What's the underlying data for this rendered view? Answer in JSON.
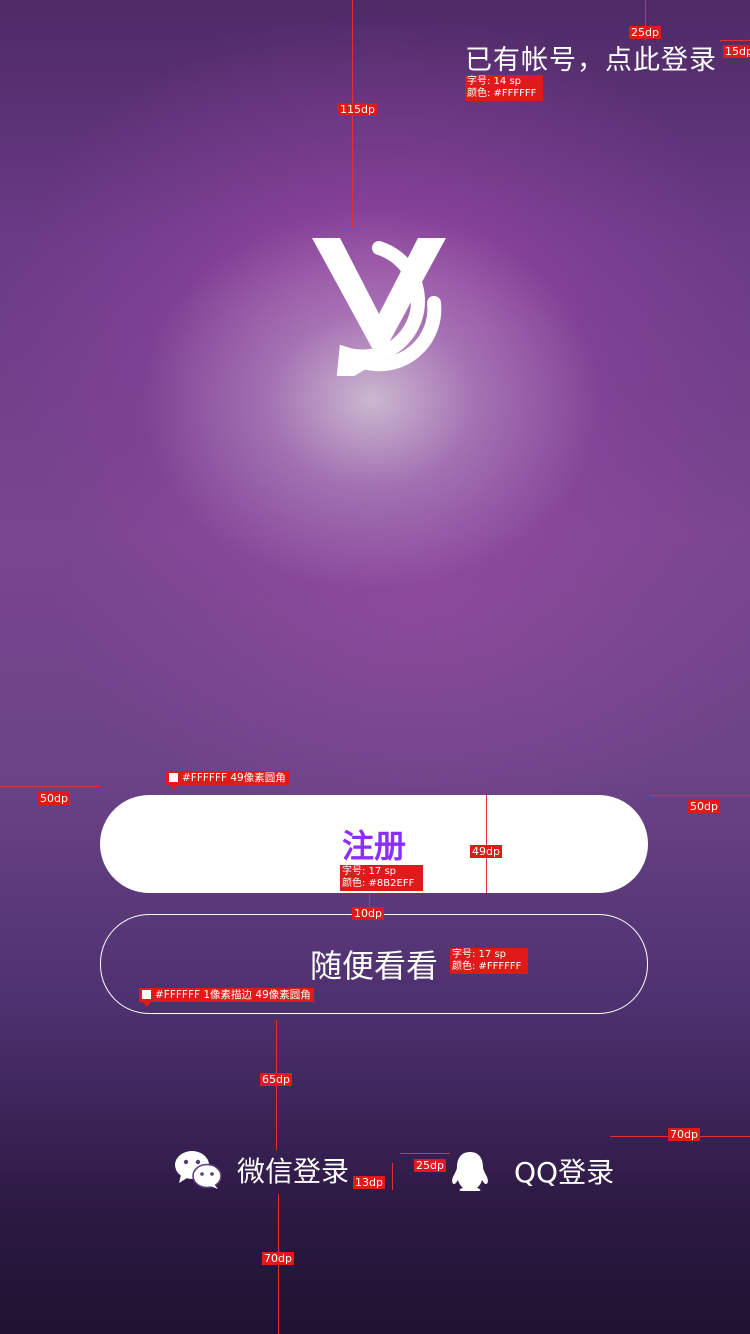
{
  "header": {
    "login_link": "已有帐号，点此登录"
  },
  "logo": {
    "name": "v-chat-logo-icon"
  },
  "buttons": {
    "register": "注册",
    "browse": "随便看看"
  },
  "social": {
    "wechat": {
      "label": "微信登录",
      "icon": "wechat-icon"
    },
    "qq": {
      "label": "QQ登录",
      "icon": "qq-icon"
    }
  },
  "colors": {
    "register_text": "#8B2EFF",
    "text": "#FFFFFF",
    "button_fill": "#FFFFFF",
    "annotation": "#E01A1A"
  },
  "annotations": {
    "top_margin": "115dp",
    "link_top": "25dp",
    "link_right": "15dp",
    "link_spec_size": "字号: 14 sp",
    "link_spec_color": "颜色: #FFFFFF",
    "btn_left": "50dp",
    "btn_right": "50dp",
    "btn_fill_note": "#FFFFFF 49像素圆角",
    "btn_height": "49dp",
    "register_spec_size": "字号: 17 sp",
    "register_spec_color": "颜色: #8B2EFF",
    "btn_gap": "10dp",
    "browse_spec_size": "字号: 17 sp",
    "browse_spec_color": "颜色: #FFFFFF",
    "browse_border_note": "#FFFFFF 1像素描边 49像素圆角",
    "social_gap_top": "65dp",
    "social_right": "70dp",
    "social_icon_gap": "25dp",
    "social_text_gap": "13dp",
    "social_bottom": "70dp"
  }
}
